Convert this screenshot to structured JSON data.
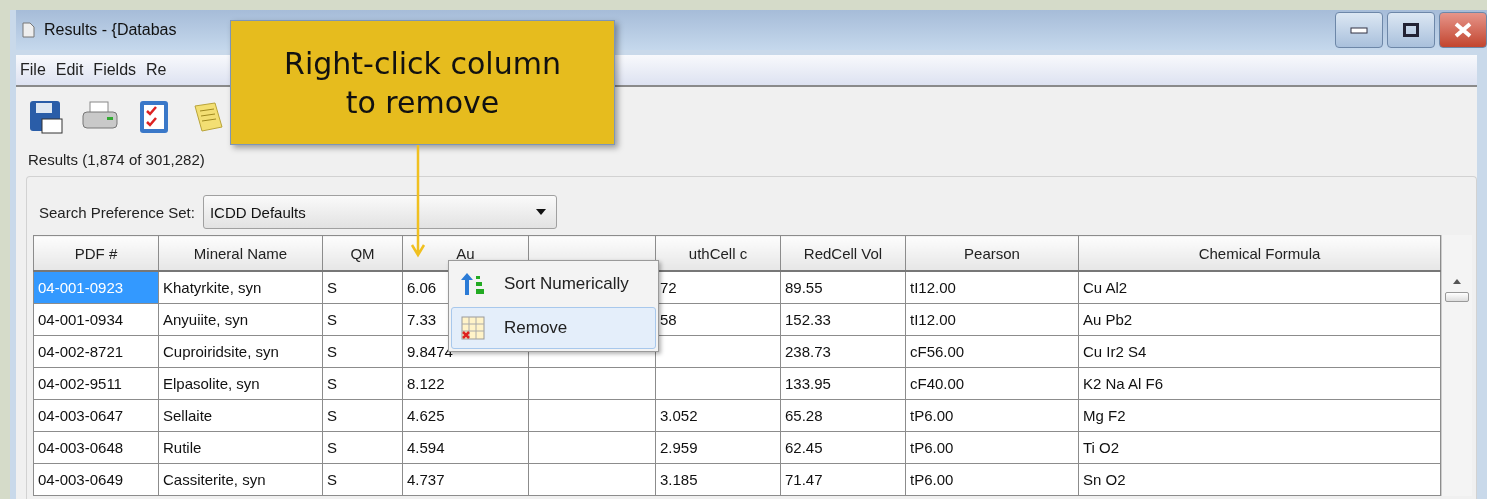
{
  "window": {
    "title": "Results - {Databas"
  },
  "menu": [
    "File",
    "Edit",
    "Fields",
    "Re"
  ],
  "toolbar": [
    {
      "kind": "save"
    },
    {
      "kind": "print"
    },
    {
      "kind": "checklist"
    },
    {
      "kind": "notes"
    }
  ],
  "results_group": {
    "title": "Results (1,874 of 301,282)"
  },
  "search_preference": {
    "label": "Search Preference Set:",
    "value": "ICDD Defaults"
  },
  "table": {
    "columns": [
      {
        "label": "PDF #"
      },
      {
        "label": "Mineral Name"
      },
      {
        "label": "QM"
      },
      {
        "label": "Au"
      },
      {},
      {
        "label": "uthCell c"
      },
      {
        "label": "RedCell Vol"
      },
      {
        "label": "Pearson"
      },
      {
        "label": "Chemical Formula"
      }
    ],
    "rows": [
      {
        "selected": true,
        "cells": [
          "04-001-0923",
          "Khatyrkite, syn",
          "S",
          "6.06",
          "",
          "72",
          "89.55",
          "tI12.00",
          "Cu Al2"
        ]
      },
      {
        "selected": false,
        "cells": [
          "04-001-0934",
          "Anyuiite, syn",
          "S",
          "7.33",
          "",
          "58",
          "152.33",
          "tI12.00",
          "Au Pb2"
        ]
      },
      {
        "selected": false,
        "cells": [
          "04-002-8721",
          "Cuproiridsite, syn",
          "S",
          "9.8474",
          "",
          "",
          "238.73",
          "cF56.00",
          "Cu Ir2 S4"
        ]
      },
      {
        "selected": false,
        "cells": [
          "04-002-9511",
          "Elpasolite, syn",
          "S",
          "8.122",
          "",
          "",
          "133.95",
          "cF40.00",
          "K2 Na Al F6"
        ]
      },
      {
        "selected": false,
        "cells": [
          "04-003-0647",
          "Sellaite",
          "S",
          "4.625",
          "",
          "3.052",
          "65.28",
          "tP6.00",
          "Mg F2"
        ]
      },
      {
        "selected": false,
        "cells": [
          "04-003-0648",
          "Rutile",
          "S",
          "4.594",
          "",
          "2.959",
          "62.45",
          "tP6.00",
          "Ti O2"
        ]
      },
      {
        "selected": false,
        "cells": [
          "04-003-0649",
          "Cassiterite, syn",
          "S",
          "4.737",
          "",
          "3.185",
          "71.47",
          "tP6.00",
          "Sn O2"
        ]
      }
    ]
  },
  "context_menu": {
    "items": [
      {
        "kind": "sort",
        "label": "Sort Numerically",
        "selected": false
      },
      {
        "kind": "remove",
        "label": "Remove",
        "selected": true
      }
    ]
  },
  "callout": {
    "text": "Right-click column to remove"
  }
}
